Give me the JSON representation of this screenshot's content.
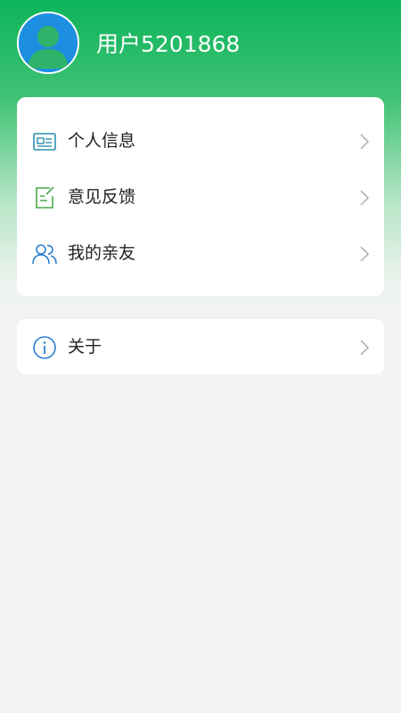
{
  "header": {
    "avatar_icon": "user-avatar-icon",
    "username": "用户5201868"
  },
  "menu": {
    "items": [
      {
        "label": "个人信息",
        "icon": "id-card-icon",
        "color": "#2a8fb0"
      },
      {
        "label": "意见反馈",
        "icon": "edit-note-icon",
        "color": "#4aa84a"
      },
      {
        "label": "我的亲友",
        "icon": "users-icon",
        "color": "#2a7fd0"
      }
    ]
  },
  "about": {
    "label": "关于",
    "icon": "info-circle-icon",
    "color": "#2a7fd0"
  },
  "colors": {
    "brand_green": "#0db45a",
    "background": "#f4f3f3",
    "chevron": "#b5b5b5"
  }
}
